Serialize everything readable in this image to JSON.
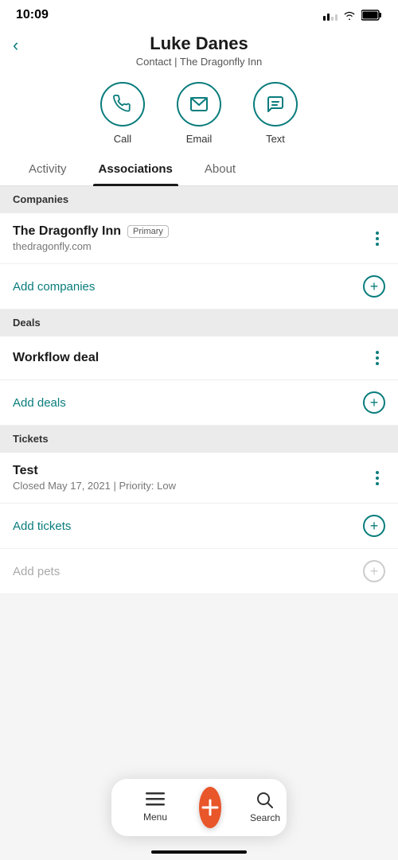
{
  "statusBar": {
    "time": "10:09"
  },
  "header": {
    "backLabel": "‹",
    "contactName": "Luke Danes",
    "contactSubtitle": "Contact | The Dragonfly Inn"
  },
  "actions": [
    {
      "id": "call",
      "label": "Call",
      "icon": "phone"
    },
    {
      "id": "email",
      "label": "Email",
      "icon": "email"
    },
    {
      "id": "text",
      "label": "Text",
      "icon": "text"
    }
  ],
  "tabs": [
    {
      "id": "activity",
      "label": "Activity",
      "active": false
    },
    {
      "id": "associations",
      "label": "Associations",
      "active": true
    },
    {
      "id": "about",
      "label": "About",
      "active": false
    }
  ],
  "sections": {
    "companies": {
      "header": "Companies",
      "items": [
        {
          "name": "The Dragonfly Inn",
          "badge": "Primary",
          "subtitle": "thedragonfly.com"
        }
      ],
      "addLabel": "Add companies"
    },
    "deals": {
      "header": "Deals",
      "items": [
        {
          "name": "Workflow deal",
          "subtitle": ""
        }
      ],
      "addLabel": "Add deals"
    },
    "tickets": {
      "header": "Tickets",
      "items": [
        {
          "name": "Test",
          "subtitle": "Closed May 17, 2021 | Priority: Low"
        }
      ],
      "addLabel": "Add tickets"
    },
    "pets": {
      "header": "",
      "items": [],
      "addLabel": "Add pets",
      "muted": true
    }
  },
  "bottomNav": {
    "menu": {
      "label": "Menu"
    },
    "fab": {
      "label": "+"
    },
    "search": {
      "label": "Search"
    }
  }
}
